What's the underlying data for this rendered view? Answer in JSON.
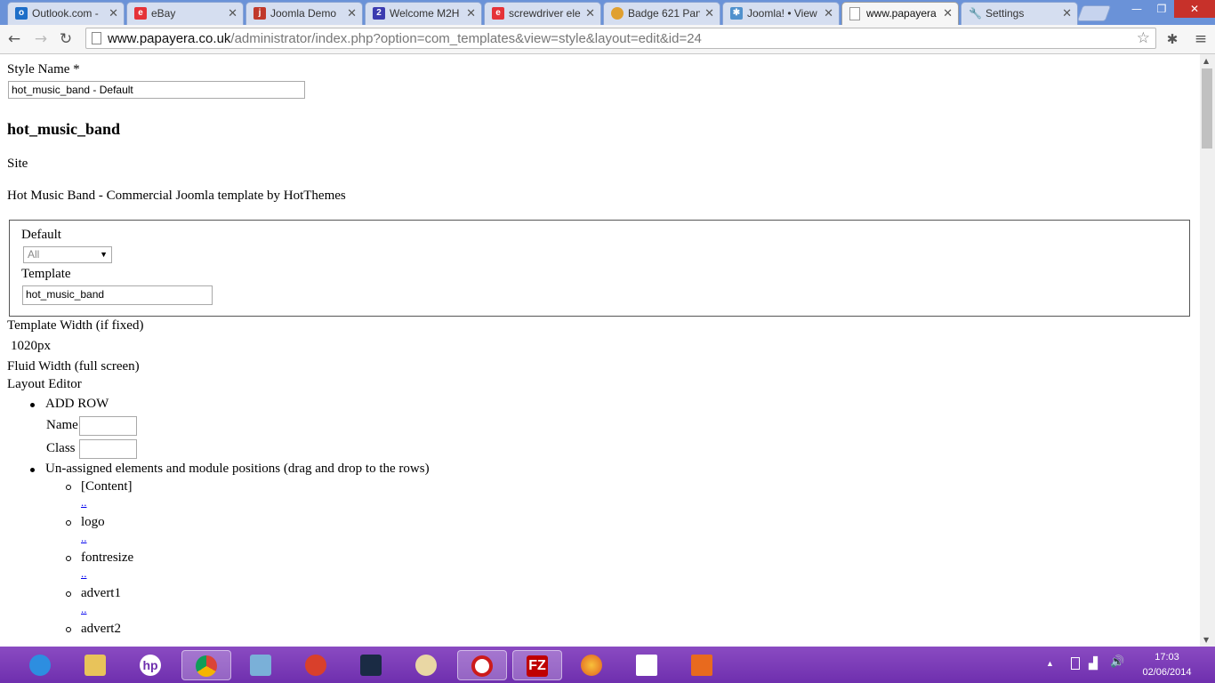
{
  "browser": {
    "tabs": [
      {
        "title": "Outlook.com -",
        "icon": "outlook-icon",
        "color": "#1e6ec8"
      },
      {
        "title": "eBay",
        "icon": "ebay-icon",
        "color": "#e53238"
      },
      {
        "title": "Joomla Demo",
        "icon": "joomla-demo-icon",
        "color": "#c0392b"
      },
      {
        "title": "Welcome M2H",
        "icon": "m2h-icon",
        "color": "#3b3bb0"
      },
      {
        "title": "screwdriver ele",
        "icon": "ebay-icon",
        "color": "#e53238"
      },
      {
        "title": "Badge 621 Pan",
        "icon": "badge-icon",
        "color": "#e0a030"
      },
      {
        "title": "Joomla! • View",
        "icon": "joomla-icon",
        "color": "#5091cd"
      },
      {
        "title": "www.papayera",
        "icon": "page-icon",
        "color": "#999999",
        "active": true
      },
      {
        "title": "Settings",
        "icon": "wrench-icon",
        "color": "#777777"
      }
    ],
    "url_host": "www.papayera.co.uk",
    "url_path": "/administrator/index.php?option=com_templates&view=style&layout=edit&id=24"
  },
  "form": {
    "style_name_label": "Style Name *",
    "style_name_value": "hot_music_band - Default",
    "template_heading": "hot_music_band",
    "client": "Site",
    "description": "Hot Music Band - Commercial Joomla template by HotThemes",
    "default_label": "Default",
    "default_value": "All",
    "template_label": "Template",
    "template_value": "hot_music_band",
    "template_width_label": "Template Width (if fixed)",
    "template_width_value": "1020px",
    "fluid_width_label": "Fluid Width (full screen)",
    "layout_editor_label": "Layout Editor",
    "add_row_label": "ADD ROW",
    "name_label": "Name",
    "class_label": "Class",
    "unassigned_label": "Un-assigned elements and module positions (drag and drop to the rows)",
    "positions": [
      "[Content]",
      "logo",
      "fontresize",
      "advert1",
      "advert2"
    ],
    "dots": ".."
  },
  "taskbar": {
    "time": "17:03",
    "date": "02/06/2014",
    "apps": [
      "ie-icon",
      "explorer-icon",
      "hp-icon",
      "chrome-icon",
      "control-panel-icon",
      "app-icon",
      "fan-icon",
      "paint-icon",
      "opera-icon",
      "filezilla-icon",
      "firefox-icon",
      "apps-icon",
      "office-icon"
    ]
  }
}
